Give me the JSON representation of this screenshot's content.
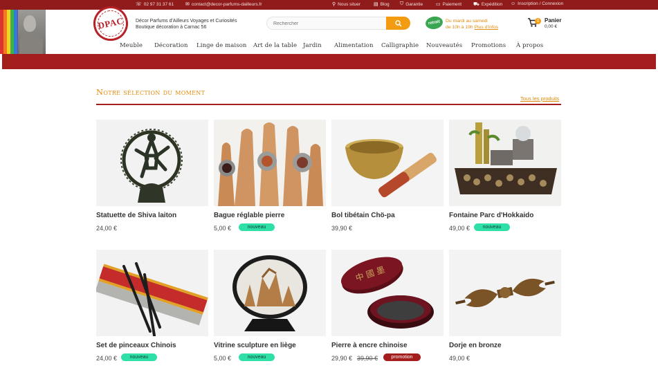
{
  "topbar": {
    "phone": "02 97 31 37 61",
    "email": "contact@decor-parfums-dailleurs.fr",
    "links": [
      "Nous situer",
      "Blog",
      "Garantie",
      "Paiement",
      "Expédition",
      "Inscription / Connexion"
    ]
  },
  "header": {
    "logo_text": "DPAC",
    "tagline_1": "Décor Parfums d'Ailleurs Voyages et Curiosités",
    "tagline_2": "Boutique décoration à Carnac 56",
    "search_placeholder": "Rechercher",
    "retrait_badge": "retrait",
    "hours_1": "Du mardi au samedi",
    "hours_2": "de 10h à 19h",
    "hours_link": "Plus d'infos",
    "cart_title": "Panier",
    "cart_amount": "0,00 €",
    "cart_count": "0"
  },
  "nav": [
    "Meuble",
    "Décoration",
    "Linge de maison",
    "Art de la table",
    "Jardin",
    "Alimentation",
    "Calligraphie",
    "Nouveautés",
    "Promotions",
    "À propos"
  ],
  "section": {
    "title": "Notre sélection du moment",
    "all_link": "Tous les produits"
  },
  "products": [
    {
      "name": "Statuette de Shiva laiton",
      "price": "24,00 €",
      "badge": ""
    },
    {
      "name": "Bague réglable pierre",
      "price": "5,00 €",
      "badge": "nouveau"
    },
    {
      "name": "Bol tibétain Chö-pa",
      "price": "39,90 €",
      "badge": ""
    },
    {
      "name": "Fontaine Parc d'Hokkaido",
      "price": "49,00 €",
      "badge": "nouveau"
    },
    {
      "name": "Set de pinceaux Chinois",
      "price": "24,00 €",
      "badge": "nouveau"
    },
    {
      "name": "Vitrine sculpture en liège",
      "price": "5,00 €",
      "badge": "nouveau"
    },
    {
      "name": "Pierre à encre chinoise",
      "price": "29,90 €",
      "old_price": "39,90 €",
      "badge": "promotion"
    },
    {
      "name": "Dorje en bronze",
      "price": "49,00 €",
      "badge": ""
    }
  ],
  "colors": {
    "brand_red": "#a31d1d",
    "accent_orange": "#e08a0b",
    "badge_green": "#2ee0a8"
  }
}
